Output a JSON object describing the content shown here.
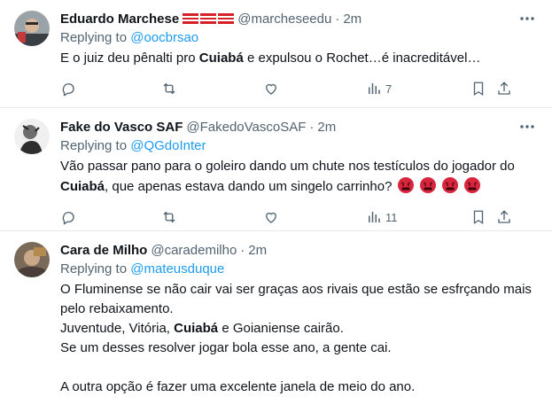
{
  "tweets": [
    {
      "name": "Eduardo Marchese",
      "handle": "@marcheseedu",
      "time": "2m",
      "replying_label": "Replying to",
      "replying_to": "@oocbrsao",
      "text_a": "E o juiz deu pênalti pro ",
      "text_bold_a": "Cuiabá",
      "text_b": " e expulsou o Rochet…é inacreditável…",
      "views": "7"
    },
    {
      "name": "Fake do Vasco SAF",
      "handle": "@FakedoVascoSAF",
      "time": "2m",
      "replying_label": "Replying to",
      "replying_to": "@QGdoInter",
      "text_a": "Vão passar pano para o goleiro dando um chute nos testículos do jogador do ",
      "text_bold_a": "Cuiabá",
      "text_b": ", que apenas estava dando um singelo carrinho?",
      "views": "11"
    },
    {
      "name": "Cara de Milho",
      "handle": "@carademilho",
      "time": "2m",
      "replying_label": "Replying to",
      "replying_to": "@mateusduque",
      "line1": "O Fluminense se não cair vai ser graças aos rivais que estão se esfrçando mais pelo rebaixamento.",
      "line2": "Juventude, Vitória, ",
      "line2_bold": "Cuiabá",
      "line2_end": " e Goianiense cairão.",
      "line3": "Se um desses resolver jogar bola esse ano, a gente cai.",
      "line4": "A outra opção é fazer uma excelente janela de meio do ano."
    }
  ],
  "separator": "·",
  "icons": [
    "more-icon",
    "reply-icon",
    "retweet-icon",
    "like-icon",
    "views-icon",
    "bookmark-icon",
    "share-icon",
    "angry-face-icon"
  ],
  "colors": {
    "link": "#1d9bf0",
    "muted": "#536471",
    "text": "#0f1419"
  }
}
